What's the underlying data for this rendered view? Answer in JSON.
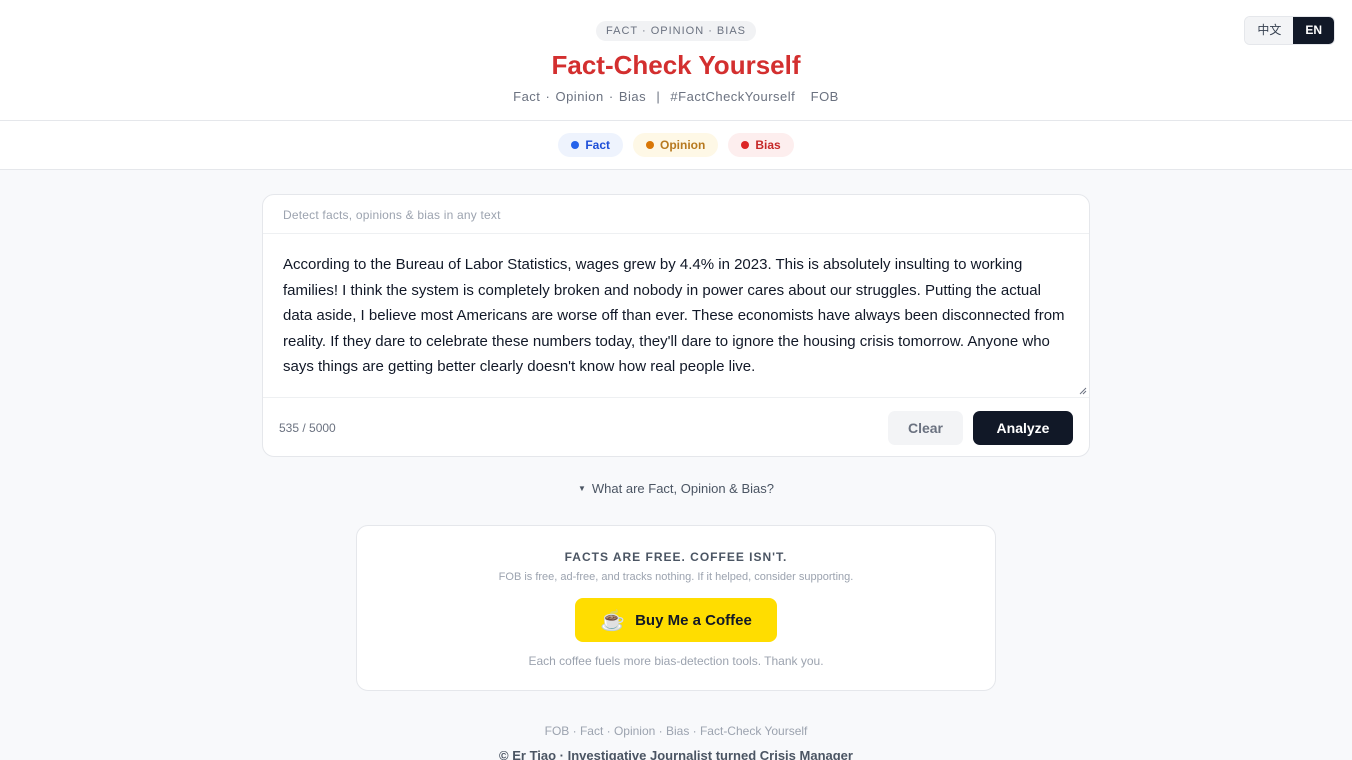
{
  "header": {
    "tag": "FACT · OPINION · BIAS",
    "title": "Fact-Check Yourself",
    "subtitle": "Fact · Opinion · Bias  |  #FactCheckYourself   FOB",
    "languages": [
      "中文",
      "EN"
    ],
    "active_language": "EN"
  },
  "legend": {
    "fact": "Fact",
    "opinion": "Opinion",
    "bias": "Bias"
  },
  "colors": {
    "title_red": "#d32f2f",
    "fact_blue": "#2563eb",
    "opinion_amber": "#d97706",
    "bias_red": "#dc2626",
    "coffee_yellow": "#ffdd00",
    "primary_dark": "#111827"
  },
  "input": {
    "label": "Detect facts, opinions & bias in any text",
    "text": "According to the Bureau of Labor Statistics, wages grew by 4.4% in 2023. This is absolutely insulting to working families! I think the system is completely broken and nobody in power cares about our struggles. Putting the actual data aside, I believe most Americans are worse off than ever. These economists have always been disconnected from reality. If they dare to celebrate these numbers today, they'll dare to ignore the housing crisis tomorrow. Anyone who says things are getting better clearly doesn't know how real people live.",
    "char_count": "535 / 5000",
    "clear_label": "Clear",
    "analyze_label": "Analyze"
  },
  "faq": {
    "toggle_label": "What are Fact, Opinion & Bias?"
  },
  "support": {
    "heading": "FACTS ARE FREE. COFFEE ISN'T.",
    "subtext": "FOB is free, ad-free, and tracks nothing. If it helped, consider supporting.",
    "button_label": "Buy Me a Coffee",
    "button_icon": "coffee-cup-icon",
    "thanks": "Each coffee fuels more bias-detection tools. Thank you."
  },
  "footer": {
    "links": "FOB · Fact · Opinion · Bias · Fact-Check Yourself",
    "copyright": "© Er Tiao · Investigative Journalist turned Crisis Manager"
  }
}
